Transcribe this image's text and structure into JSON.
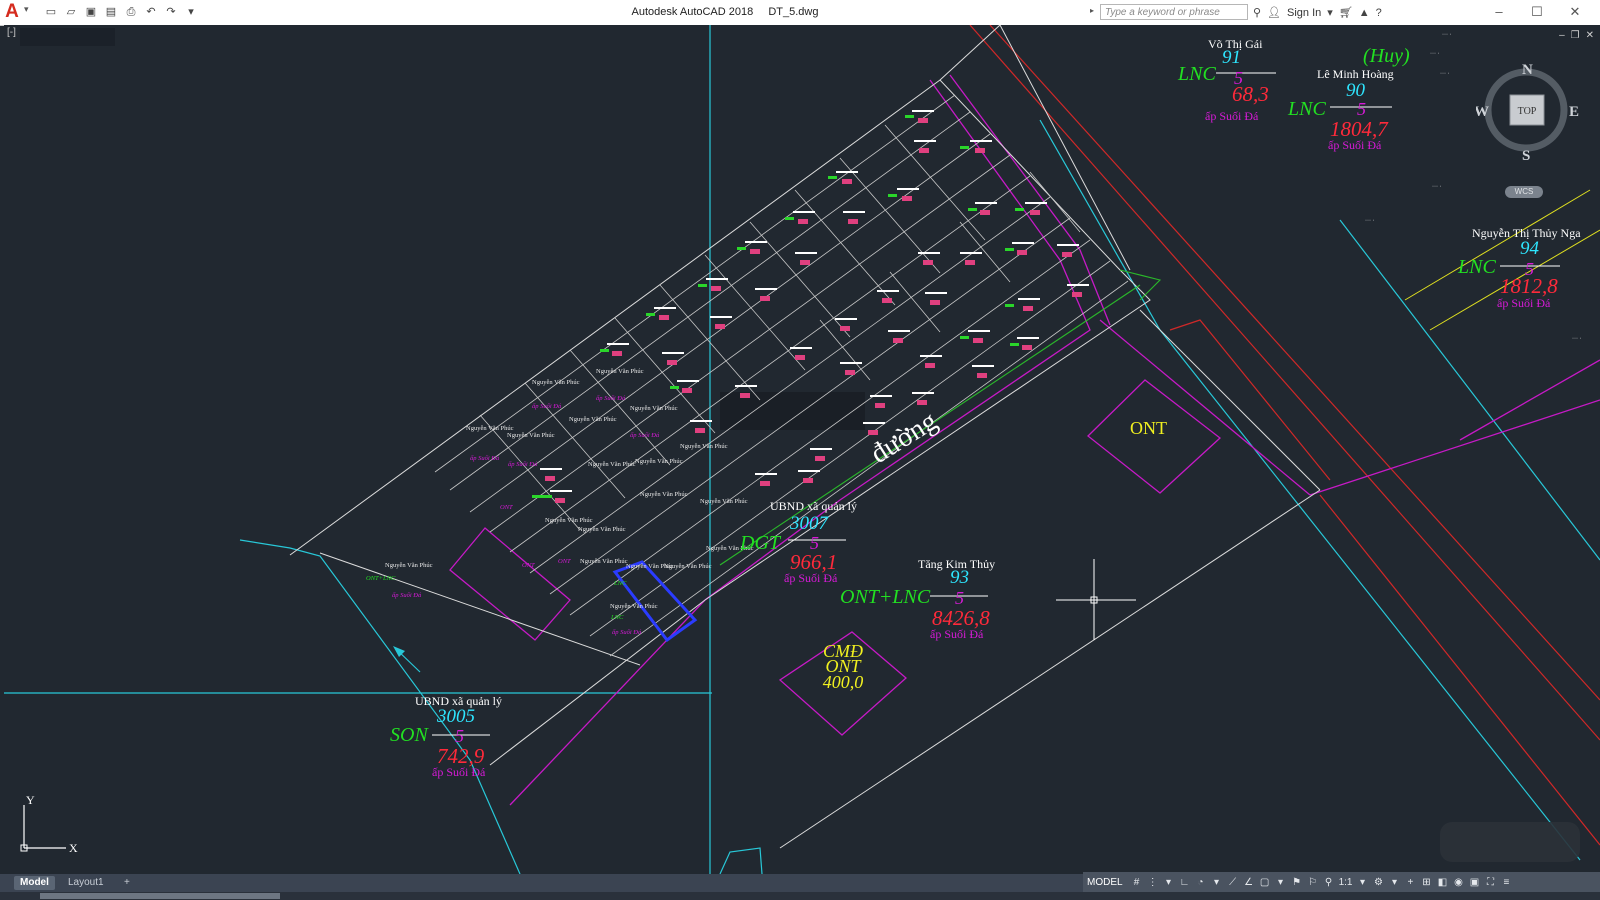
{
  "app": {
    "title": "Autodesk AutoCAD 2018",
    "file": "DT_5.dwg",
    "logo": "A",
    "search_placeholder": "Type a keyword or phrase",
    "sign_in": "Sign In"
  },
  "viewport": {
    "control": "[-]",
    "viewcube": {
      "n": "N",
      "s": "S",
      "e": "E",
      "w": "W",
      "top": "TOP",
      "wcs": "WCS"
    },
    "ucs": {
      "x": "X",
      "y": "Y"
    }
  },
  "drawing": {
    "road_label": "đường",
    "zone_ont": "ONT",
    "cmd_box": {
      "line1": "CMĐ",
      "line2": "ONT",
      "line3": "400,0"
    },
    "parcels": [
      {
        "owner": "Võ Thị Gái",
        "use": "LNC",
        "no": "91",
        "sheet": "5",
        "area": "68,3",
        "place": "ấp Suối Đá"
      },
      {
        "owner": "Lê Minh Hoàng",
        "use": "LNC",
        "no": "90",
        "sheet": "5",
        "area": "1804,7",
        "place": "ấp Suối Đá",
        "extra": "(Huy)"
      },
      {
        "owner": "Nguyễn Thị Thủy Nga",
        "use": "LNC",
        "no": "94",
        "sheet": "5",
        "area": "1812,8",
        "place": "ấp Suối Đá"
      },
      {
        "owner": "UBND xã quản lý",
        "use": "DGT",
        "no": "3007",
        "sheet": "5",
        "area": "966,1",
        "place": "ấp Suối Đá"
      },
      {
        "owner": "Tăng Kim Thủy",
        "use": "ONT+LNC",
        "no": "93",
        "sheet": "5",
        "area": "8426,8",
        "place": "ấp Suối Đá"
      },
      {
        "owner": "UBND xã quản lý",
        "use": "SON",
        "no": "3005",
        "sheet": "5",
        "area": "742,9",
        "place": "ấp Suối Đá"
      }
    ],
    "small_owner": "Nguyễn Văn Phúc"
  },
  "tabs": {
    "model": "Model",
    "layout1": "Layout1",
    "add": "+"
  },
  "status": {
    "model": "MODEL",
    "scale": "1:1"
  },
  "colors": {
    "background": "#212830",
    "green_label": "#22e022",
    "cyan_label": "#2ee6ff",
    "red_label": "#ff2a3a",
    "magenta": "#d81ad8",
    "yellow": "#f0f02a"
  }
}
